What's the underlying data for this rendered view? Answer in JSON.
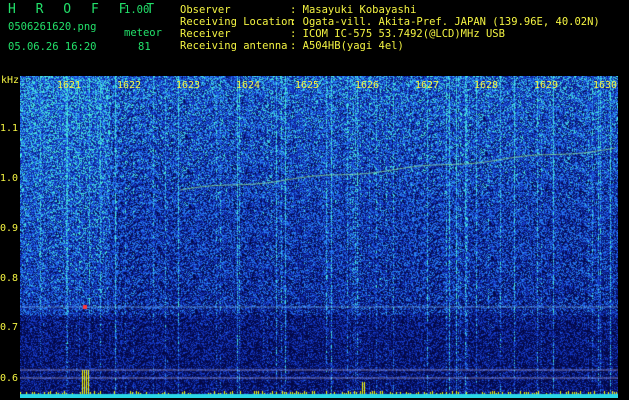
{
  "header": {
    "brand": "H R O F F T",
    "version": "1.00",
    "filename": "0506261620.png",
    "datetime": "05.06.26 16:20",
    "meteor_label": "meteor",
    "meteor_count": "81",
    "fields": [
      {
        "label": "Observer",
        "value": ": Masayuki Kobayashi"
      },
      {
        "label": "Receiving Location",
        "value": ": Ogata-vill. Akita-Pref. JAPAN (139.96E, 40.02N)"
      },
      {
        "label": "Receiver",
        "value": ": ICOM IC-575 53.7492(@LCD)MHz USB"
      },
      {
        "label": "Receiving antenna",
        "value": ": A504HB(yagi 4el)"
      }
    ]
  },
  "axis": {
    "unit": "kHz",
    "y_ticks": [
      "1.1",
      "1.0",
      "0.9",
      "0.8",
      "0.7",
      "0.6"
    ],
    "x_ticks": [
      "1621",
      "1622",
      "1623",
      "1624",
      "1625",
      "1626",
      "1627",
      "1628",
      "1629",
      "1630"
    ]
  },
  "colors": {
    "background": "#000000",
    "header_text": "#22e06a",
    "header_value_text": "#f4f442",
    "spectrum_low": "#06105e",
    "spectrum_mid": "#1e4fd8",
    "spectrum_high": "#37d8e8",
    "echo": "#a8f0a0",
    "meteor_bars": "#ffff00"
  }
}
